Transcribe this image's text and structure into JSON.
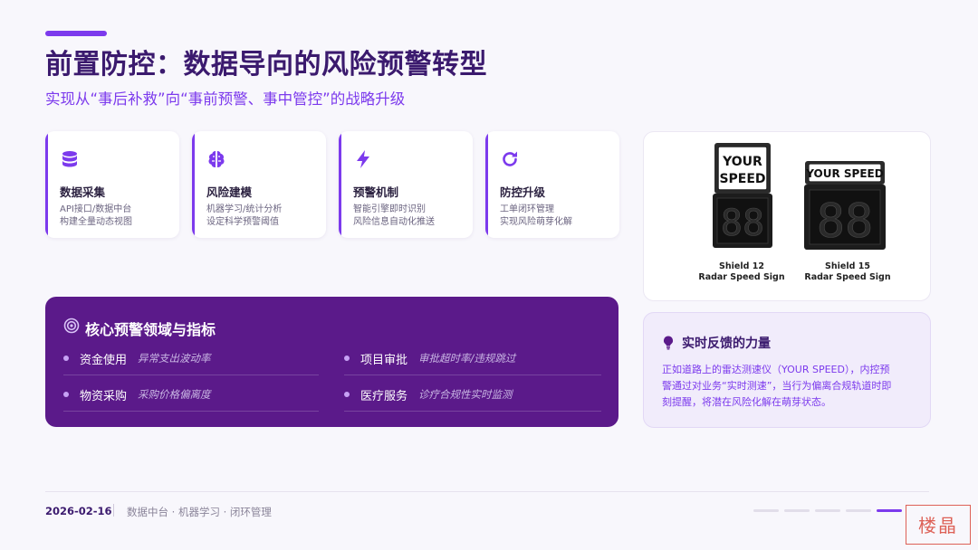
{
  "header": {
    "title": "前置防控：数据导向的风险预警转型",
    "subtitle": "实现从“事后补救”向“事前预警、事中管控”的战略升级"
  },
  "cards": [
    {
      "icon": "database-icon",
      "title": "数据采集",
      "lines": [
        "API接口/数据中台",
        "构建全量动态视图"
      ]
    },
    {
      "icon": "brain-icon",
      "title": "风险建模",
      "lines": [
        "机器学习/统计分析",
        "设定科学预警阈值"
      ]
    },
    {
      "icon": "bolt-icon",
      "title": "预警机制",
      "lines": [
        "智能引擎即时识别",
        "风险信息自动化推送"
      ]
    },
    {
      "icon": "refresh-icon",
      "title": "防控升级",
      "lines": [
        "工单闭环管理",
        "实现风险萌芽化解"
      ]
    }
  ],
  "signs": [
    {
      "header": "YOUR SPEED",
      "digits": "88",
      "caption_line1": "Shield 12",
      "caption_line2": "Radar Speed Sign"
    },
    {
      "header": "YOUR SPEED",
      "digits": "88",
      "caption_line1": "Shield 15",
      "caption_line2": "Radar Speed Sign"
    }
  ],
  "core": {
    "title": "核心预警领域与指标",
    "metrics": [
      {
        "name": "资金使用",
        "desc": "异常支出波动率"
      },
      {
        "name": "项目审批",
        "desc": "审批超时率/违规跳过"
      },
      {
        "name": "物资采购",
        "desc": "采购价格偏离度"
      },
      {
        "name": "医疗服务",
        "desc": "诊疗合规性实时监测"
      }
    ]
  },
  "feedback": {
    "title": "实时反馈的力量",
    "lines": [
      "正如道路上的雷达测速仪（YOUR SPEED），内控预",
      "警通过对业务“实时测速”，当行为偏离合规轨道时即",
      "刻提醒，将潜在风险化解在萌芽状态。"
    ]
  },
  "footer": {
    "date": "2026-02-16",
    "tags": "数据中台 · 机器学习 · 闭环管理",
    "pager_total": 5,
    "pager_active": 5
  },
  "watermark": "楼晶",
  "colors": {
    "accent": "#7c3aed",
    "core_bg": "#5b1a8a",
    "title": "#3b1a6e"
  }
}
